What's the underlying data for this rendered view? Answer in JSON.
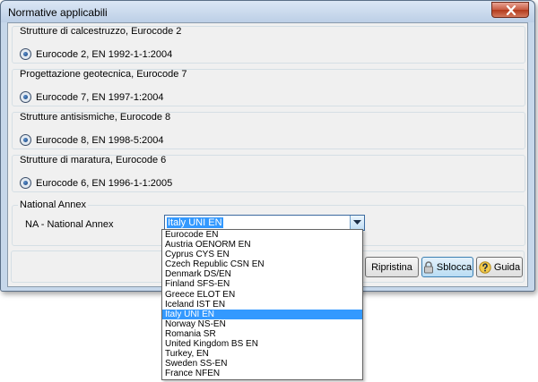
{
  "window": {
    "title": "Normative applicabili"
  },
  "groups": [
    {
      "label": "Strutture di calcestruzzo, Eurocode 2",
      "option": "Eurocode 2, EN  1992-1-1:2004"
    },
    {
      "label": "Progettazione geotecnica, Eurocode 7",
      "option": "Eurocode 7, EN  1997-1:2004"
    },
    {
      "label": "Strutture antisismiche, Eurocode 8",
      "option": "Eurocode 8, EN  1998-5:2004"
    },
    {
      "label": "Strutture di maratura, Eurocode 6",
      "option": "Eurocode 6, EN  1996-1-1:2005"
    }
  ],
  "national_annex": {
    "group_label": "National Annex",
    "field_label": "NA - National Annex",
    "selected": "Italy UNI EN",
    "options": [
      "Eurocode EN",
      "Austria OENORM EN",
      "Cyprus CYS EN",
      "Czech Republic CSN EN",
      "Denmark DS/EN",
      "Finland SFS-EN",
      "Greece ELOT EN",
      "Iceland IST EN",
      "Italy UNI EN",
      "Norway NS-EN",
      "Romania SR",
      "United Kingdom  BS EN",
      "Turkey, EN",
      "Sweden SS-EN",
      "France NFEN"
    ]
  },
  "buttons": {
    "reset": "Ripristina",
    "unlock": "Sblocca",
    "help": "Guida"
  },
  "colors": {
    "selection": "#3399ff",
    "title_bar": "#c6d7ea"
  }
}
